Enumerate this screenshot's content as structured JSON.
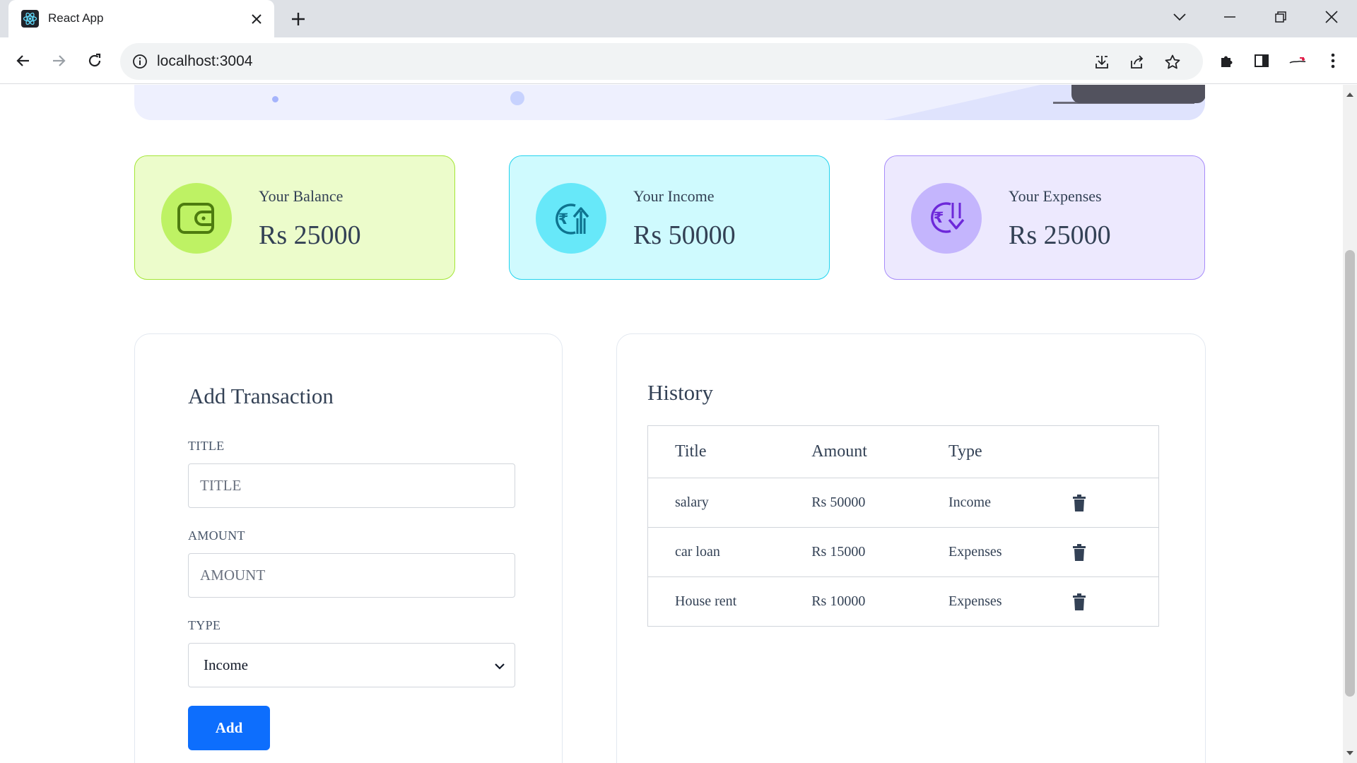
{
  "browser": {
    "tab_title": "React App",
    "url": "localhost:3004"
  },
  "summary": {
    "balance": {
      "label": "Your Balance",
      "value": "Rs 25000"
    },
    "income": {
      "label": "Your Income",
      "value": "Rs 50000"
    },
    "expenses": {
      "label": "Your Expenses",
      "value": "Rs 25000"
    }
  },
  "form": {
    "heading": "Add Transaction",
    "title_label": "TITLE",
    "title_placeholder": "TITLE",
    "amount_label": "AMOUNT",
    "amount_placeholder": "AMOUNT",
    "type_label": "TYPE",
    "type_selected": "Income",
    "submit_label": "Add"
  },
  "history": {
    "heading": "History",
    "columns": [
      "Title",
      "Amount",
      "Type"
    ],
    "rows": [
      {
        "title": "salary",
        "amount": "Rs 50000",
        "type": "Income"
      },
      {
        "title": "car loan",
        "amount": "Rs 15000",
        "type": "Expenses"
      },
      {
        "title": "House rent",
        "amount": "Rs 10000",
        "type": "Expenses"
      }
    ]
  },
  "colors": {
    "balance_accent": "#65a30d",
    "income_accent": "#0891b2",
    "expenses_accent": "#7c3aed",
    "primary_button": "#0d6efd"
  },
  "icons": {
    "balance": "wallet-icon",
    "income": "rupee-arrow-up-icon",
    "expenses": "rupee-arrow-down-icon",
    "row_action": "trash-icon"
  }
}
